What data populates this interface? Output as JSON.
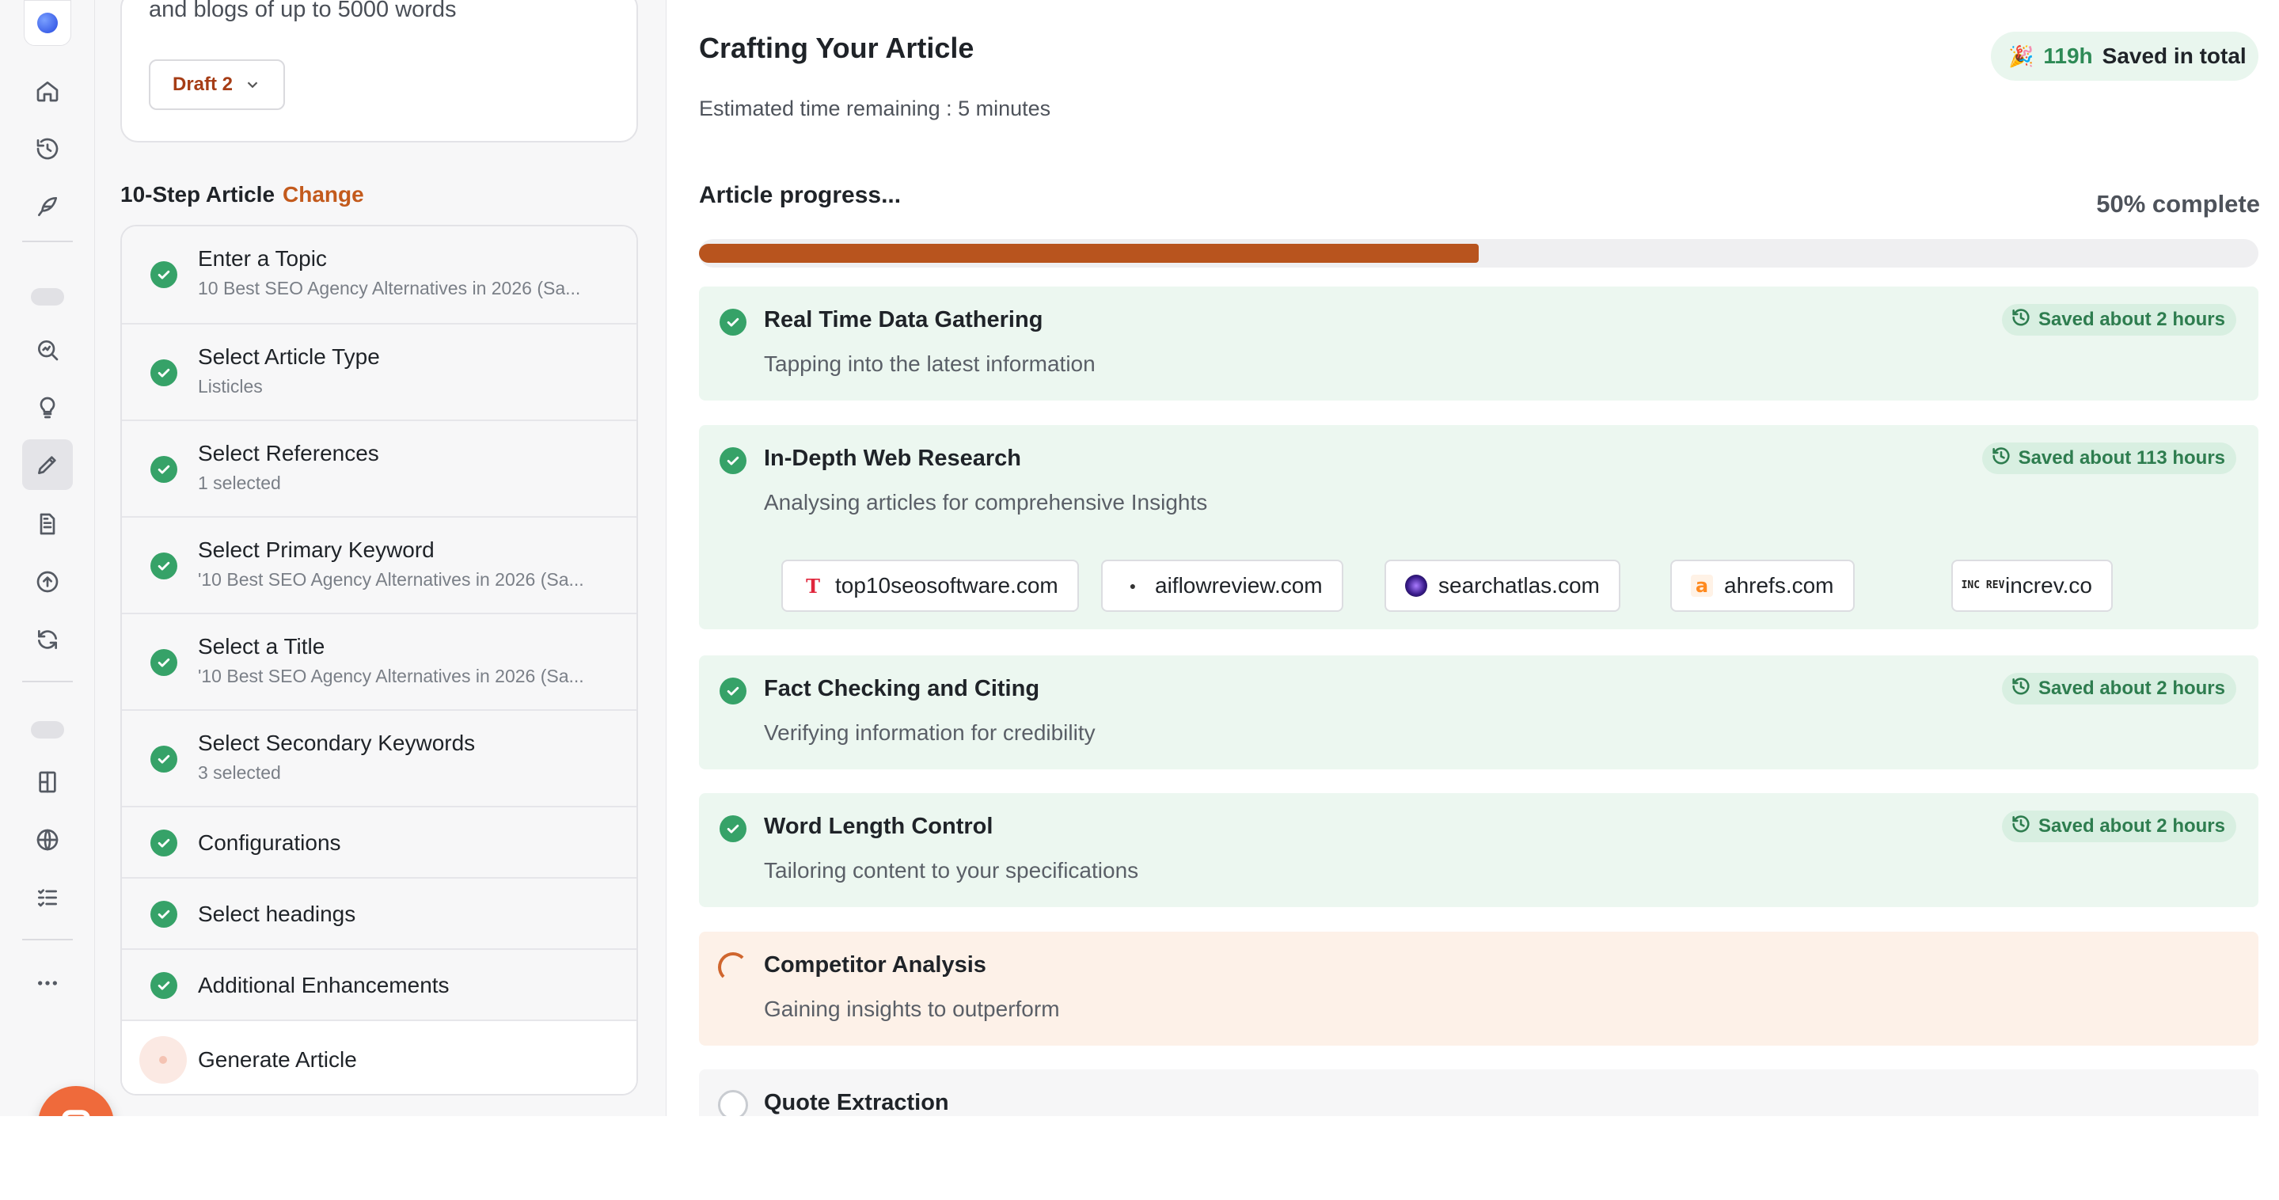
{
  "sidebar_rail": {
    "icons": [
      "home-icon",
      "history-icon",
      "feather-icon",
      "search-chart-icon",
      "lightbulb-icon",
      "pencil-icon",
      "document-icon",
      "upload-circle-icon",
      "refresh-icon",
      "book-icon",
      "globe-icon",
      "checklist-icon",
      "more-icon"
    ],
    "active": "pencil-icon"
  },
  "intro": {
    "text": "and blogs of up to 5000 words",
    "draft_label": "Draft 2"
  },
  "steps_section": {
    "heading": "10-Step Article",
    "change_label": "Change",
    "steps": [
      {
        "title": "Enter a Topic",
        "subtitle": "10 Best SEO Agency Alternatives in 2026 (Sa...",
        "status": "done"
      },
      {
        "title": "Select Article Type",
        "subtitle": "Listicles",
        "status": "done"
      },
      {
        "title": "Select References",
        "subtitle": "1 selected",
        "status": "done"
      },
      {
        "title": "Select Primary Keyword",
        "subtitle": "'10 Best SEO Agency Alternatives in 2026 (Sa...",
        "status": "done"
      },
      {
        "title": "Select a Title",
        "subtitle": "'10 Best SEO Agency Alternatives in 2026 (Sa...",
        "status": "done"
      },
      {
        "title": "Select Secondary Keywords",
        "subtitle": "3 selected",
        "status": "done"
      },
      {
        "title": "Configurations",
        "subtitle": "",
        "status": "done"
      },
      {
        "title": "Select headings",
        "subtitle": "",
        "status": "done"
      },
      {
        "title": "Additional Enhancements",
        "subtitle": "",
        "status": "done"
      },
      {
        "title": "Generate Article",
        "subtitle": "",
        "status": "pending"
      }
    ]
  },
  "main": {
    "title": "Crafting Your Article",
    "eta": "Estimated time remaining : 5 minutes",
    "saved_total": {
      "emoji": "🎉",
      "hours": "119h",
      "label": "Saved in total"
    },
    "progress": {
      "label": "Article progress...",
      "percent_text": "50% complete",
      "fraction": 0.5
    },
    "tasks": [
      {
        "title": "Real Time Data Gathering",
        "subtitle": "Tapping into the latest information",
        "status": "done",
        "saved": "Saved about 2 hours"
      },
      {
        "title": "In-Depth Web Research",
        "subtitle": "Analysing articles for comprehensive Insights",
        "status": "done",
        "saved": "Saved about 113 hours",
        "sources": [
          {
            "name": "top10seosoftware.com",
            "icon": "top10-favicon-icon",
            "glyph": "T"
          },
          {
            "name": "aiflowreview.com",
            "icon": "aiflowreview-favicon-icon",
            "glyph": "●"
          },
          {
            "name": "searchatlas.com",
            "icon": "searchatlas-favicon-icon",
            "glyph": ""
          },
          {
            "name": "ahrefs.com",
            "icon": "ahrefs-favicon-icon",
            "glyph": "a"
          },
          {
            "name": "increv.co",
            "icon": "increv-favicon-icon",
            "glyph": "INC REV"
          }
        ]
      },
      {
        "title": "Fact Checking and Citing",
        "subtitle": "Verifying information for credibility",
        "status": "done",
        "saved": "Saved about 2 hours"
      },
      {
        "title": "Word Length Control",
        "subtitle": "Tailoring content to your specifications",
        "status": "done",
        "saved": "Saved about 2 hours"
      },
      {
        "title": "Competitor Analysis",
        "subtitle": "Gaining insights to outperform",
        "status": "running",
        "saved": ""
      },
      {
        "title": "Quote Extraction",
        "subtitle": "",
        "status": "todo",
        "saved": ""
      }
    ]
  }
}
